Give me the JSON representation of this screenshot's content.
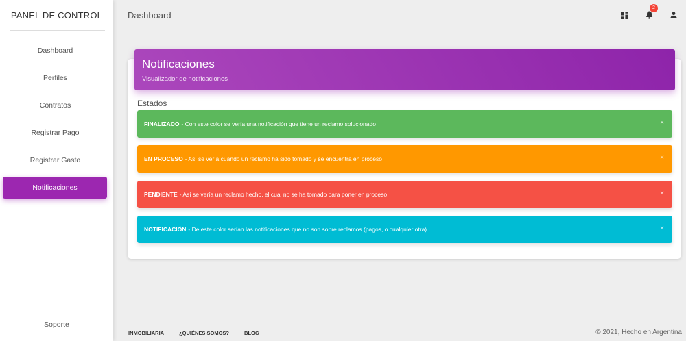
{
  "sidebar": {
    "brand": "PANEL DE CONTROL",
    "items": [
      {
        "label": "Dashboard"
      },
      {
        "label": "Perfiles"
      },
      {
        "label": "Contratos"
      },
      {
        "label": "Registrar Pago"
      },
      {
        "label": "Registrar Gasto"
      },
      {
        "label": "Notificaciones",
        "active": true
      }
    ],
    "support": "Soporte"
  },
  "topbar": {
    "title": "Dashboard",
    "icons": [
      "dashboard-icon",
      "notifications-icon",
      "person-icon"
    ],
    "notification_count": "2"
  },
  "card": {
    "title": "Notificaciones",
    "subtitle": "Visualizador de notificaciones",
    "section": "Estados",
    "alerts": [
      {
        "tag": "FINALIZADO",
        "text": "- Con este color se vería una notificación que tiene un reclamo solucionado",
        "color": "#5cb85c"
      },
      {
        "tag": "EN PROCESO",
        "text": "- Así se vería cuando un reclamo ha sido tomado y se encuentra en proceso",
        "color": "#ff9800"
      },
      {
        "tag": "PENDIENTE",
        "text": "- Así se vería un reclamo hecho, el cual no se ha tomado para poner en proceso",
        "color": "#f55145"
      },
      {
        "tag": "NOTIFICACIÓN",
        "text": "- De este color serían las notificaciones que no son sobre reclamos (pagos, o cualquier otra)",
        "color": "#00bcd4"
      }
    ],
    "close_symbol": "×"
  },
  "footer": {
    "links": [
      "INMOBILIARIA",
      "¿QUIÉNES SOMOS?",
      "BLOG"
    ],
    "copyright": "© 2021, Hecho en Argentina"
  },
  "colors": {
    "accent": "#9c27b0"
  }
}
